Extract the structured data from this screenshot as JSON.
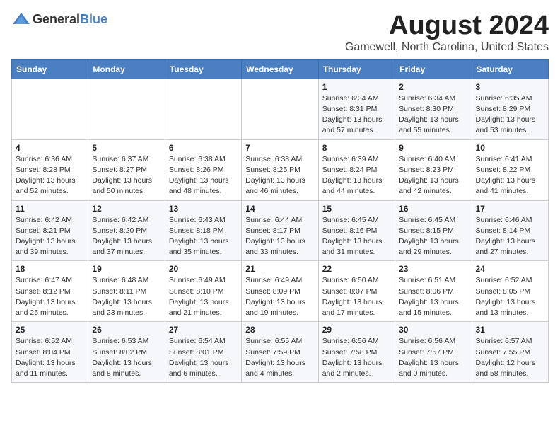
{
  "logo": {
    "text_general": "General",
    "text_blue": "Blue"
  },
  "title": {
    "month": "August 2024",
    "location": "Gamewell, North Carolina, United States"
  },
  "header": {
    "days": [
      "Sunday",
      "Monday",
      "Tuesday",
      "Wednesday",
      "Thursday",
      "Friday",
      "Saturday"
    ]
  },
  "weeks": [
    {
      "row_bg": "light",
      "days": [
        {
          "num": "",
          "info": ""
        },
        {
          "num": "",
          "info": ""
        },
        {
          "num": "",
          "info": ""
        },
        {
          "num": "",
          "info": ""
        },
        {
          "num": "1",
          "info": "Sunrise: 6:34 AM\nSunset: 8:31 PM\nDaylight: 13 hours\nand 57 minutes."
        },
        {
          "num": "2",
          "info": "Sunrise: 6:34 AM\nSunset: 8:30 PM\nDaylight: 13 hours\nand 55 minutes."
        },
        {
          "num": "3",
          "info": "Sunrise: 6:35 AM\nSunset: 8:29 PM\nDaylight: 13 hours\nand 53 minutes."
        }
      ]
    },
    {
      "row_bg": "white",
      "days": [
        {
          "num": "4",
          "info": "Sunrise: 6:36 AM\nSunset: 8:28 PM\nDaylight: 13 hours\nand 52 minutes."
        },
        {
          "num": "5",
          "info": "Sunrise: 6:37 AM\nSunset: 8:27 PM\nDaylight: 13 hours\nand 50 minutes."
        },
        {
          "num": "6",
          "info": "Sunrise: 6:38 AM\nSunset: 8:26 PM\nDaylight: 13 hours\nand 48 minutes."
        },
        {
          "num": "7",
          "info": "Sunrise: 6:38 AM\nSunset: 8:25 PM\nDaylight: 13 hours\nand 46 minutes."
        },
        {
          "num": "8",
          "info": "Sunrise: 6:39 AM\nSunset: 8:24 PM\nDaylight: 13 hours\nand 44 minutes."
        },
        {
          "num": "9",
          "info": "Sunrise: 6:40 AM\nSunset: 8:23 PM\nDaylight: 13 hours\nand 42 minutes."
        },
        {
          "num": "10",
          "info": "Sunrise: 6:41 AM\nSunset: 8:22 PM\nDaylight: 13 hours\nand 41 minutes."
        }
      ]
    },
    {
      "row_bg": "light",
      "days": [
        {
          "num": "11",
          "info": "Sunrise: 6:42 AM\nSunset: 8:21 PM\nDaylight: 13 hours\nand 39 minutes."
        },
        {
          "num": "12",
          "info": "Sunrise: 6:42 AM\nSunset: 8:20 PM\nDaylight: 13 hours\nand 37 minutes."
        },
        {
          "num": "13",
          "info": "Sunrise: 6:43 AM\nSunset: 8:18 PM\nDaylight: 13 hours\nand 35 minutes."
        },
        {
          "num": "14",
          "info": "Sunrise: 6:44 AM\nSunset: 8:17 PM\nDaylight: 13 hours\nand 33 minutes."
        },
        {
          "num": "15",
          "info": "Sunrise: 6:45 AM\nSunset: 8:16 PM\nDaylight: 13 hours\nand 31 minutes."
        },
        {
          "num": "16",
          "info": "Sunrise: 6:45 AM\nSunset: 8:15 PM\nDaylight: 13 hours\nand 29 minutes."
        },
        {
          "num": "17",
          "info": "Sunrise: 6:46 AM\nSunset: 8:14 PM\nDaylight: 13 hours\nand 27 minutes."
        }
      ]
    },
    {
      "row_bg": "white",
      "days": [
        {
          "num": "18",
          "info": "Sunrise: 6:47 AM\nSunset: 8:12 PM\nDaylight: 13 hours\nand 25 minutes."
        },
        {
          "num": "19",
          "info": "Sunrise: 6:48 AM\nSunset: 8:11 PM\nDaylight: 13 hours\nand 23 minutes."
        },
        {
          "num": "20",
          "info": "Sunrise: 6:49 AM\nSunset: 8:10 PM\nDaylight: 13 hours\nand 21 minutes."
        },
        {
          "num": "21",
          "info": "Sunrise: 6:49 AM\nSunset: 8:09 PM\nDaylight: 13 hours\nand 19 minutes."
        },
        {
          "num": "22",
          "info": "Sunrise: 6:50 AM\nSunset: 8:07 PM\nDaylight: 13 hours\nand 17 minutes."
        },
        {
          "num": "23",
          "info": "Sunrise: 6:51 AM\nSunset: 8:06 PM\nDaylight: 13 hours\nand 15 minutes."
        },
        {
          "num": "24",
          "info": "Sunrise: 6:52 AM\nSunset: 8:05 PM\nDaylight: 13 hours\nand 13 minutes."
        }
      ]
    },
    {
      "row_bg": "light",
      "days": [
        {
          "num": "25",
          "info": "Sunrise: 6:52 AM\nSunset: 8:04 PM\nDaylight: 13 hours\nand 11 minutes."
        },
        {
          "num": "26",
          "info": "Sunrise: 6:53 AM\nSunset: 8:02 PM\nDaylight: 13 hours\nand 8 minutes."
        },
        {
          "num": "27",
          "info": "Sunrise: 6:54 AM\nSunset: 8:01 PM\nDaylight: 13 hours\nand 6 minutes."
        },
        {
          "num": "28",
          "info": "Sunrise: 6:55 AM\nSunset: 7:59 PM\nDaylight: 13 hours\nand 4 minutes."
        },
        {
          "num": "29",
          "info": "Sunrise: 6:56 AM\nSunset: 7:58 PM\nDaylight: 13 hours\nand 2 minutes."
        },
        {
          "num": "30",
          "info": "Sunrise: 6:56 AM\nSunset: 7:57 PM\nDaylight: 13 hours\nand 0 minutes."
        },
        {
          "num": "31",
          "info": "Sunrise: 6:57 AM\nSunset: 7:55 PM\nDaylight: 12 hours\nand 58 minutes."
        }
      ]
    }
  ]
}
